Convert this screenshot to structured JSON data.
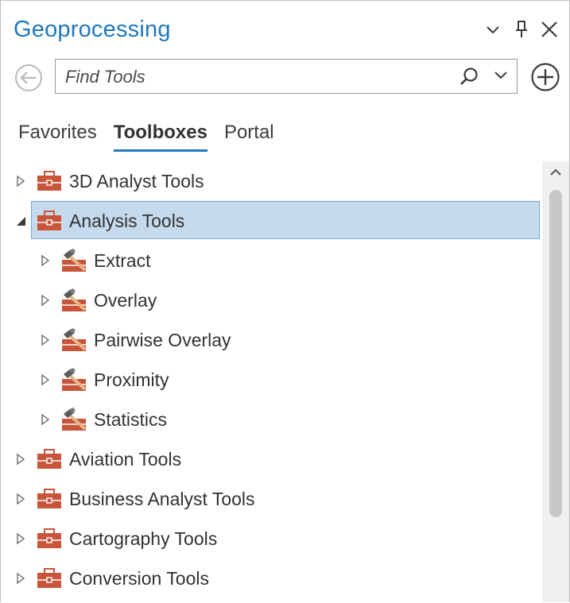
{
  "pane": {
    "title": "Geoprocessing",
    "header_icons": [
      "chevron-down-icon",
      "pin-icon",
      "close-icon"
    ]
  },
  "search": {
    "placeholder": "Find Tools",
    "back_icon": "back-arrow-icon",
    "search_icon": "magnifier-icon",
    "dropdown_icon": "chevron-down-icon",
    "add_icon": "plus-circle-icon"
  },
  "tabs": [
    {
      "label": "Favorites",
      "active": false
    },
    {
      "label": "Toolboxes",
      "active": true
    },
    {
      "label": "Portal",
      "active": false
    }
  ],
  "tree": {
    "items": [
      {
        "label": "3D Analyst Tools",
        "level": 0,
        "expanded": false,
        "icon": "toolbox-icon",
        "selected": false
      },
      {
        "label": "Analysis Tools",
        "level": 0,
        "expanded": true,
        "icon": "toolbox-icon",
        "selected": true
      },
      {
        "label": "Extract",
        "level": 1,
        "expanded": false,
        "icon": "toolset-icon",
        "selected": false
      },
      {
        "label": "Overlay",
        "level": 1,
        "expanded": false,
        "icon": "toolset-icon",
        "selected": false
      },
      {
        "label": "Pairwise Overlay",
        "level": 1,
        "expanded": false,
        "icon": "toolset-icon",
        "selected": false
      },
      {
        "label": "Proximity",
        "level": 1,
        "expanded": false,
        "icon": "toolset-icon",
        "selected": false
      },
      {
        "label": "Statistics",
        "level": 1,
        "expanded": false,
        "icon": "toolset-icon",
        "selected": false
      },
      {
        "label": "Aviation Tools",
        "level": 0,
        "expanded": false,
        "icon": "toolbox-icon",
        "selected": false
      },
      {
        "label": "Business Analyst Tools",
        "level": 0,
        "expanded": false,
        "icon": "toolbox-icon",
        "selected": false
      },
      {
        "label": "Cartography Tools",
        "level": 0,
        "expanded": false,
        "icon": "toolbox-icon",
        "selected": false
      },
      {
        "label": "Conversion Tools",
        "level": 0,
        "expanded": false,
        "icon": "toolbox-icon",
        "selected": false
      }
    ]
  },
  "colors": {
    "accent": "#1f78bd",
    "selection_bg": "#c5daec",
    "selection_border": "#78a9d5",
    "toolbox": "#c8553a"
  }
}
